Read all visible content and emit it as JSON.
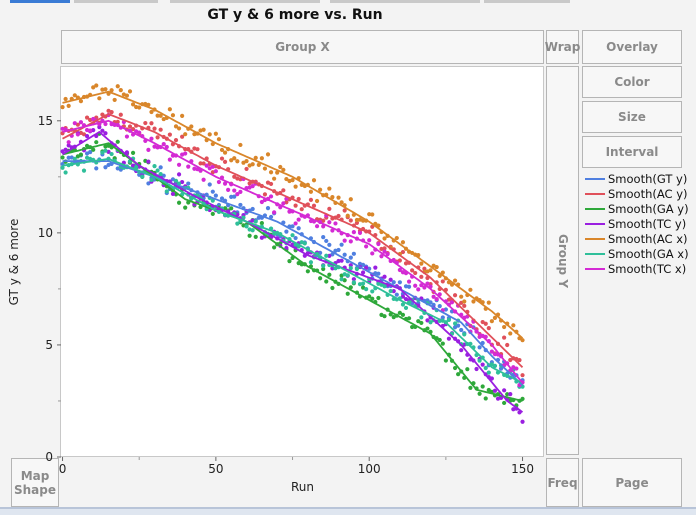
{
  "title": "GT y & 6 more vs. Run",
  "zones": {
    "group_x": "Group X",
    "wrap": "Wrap",
    "overlay": "Overlay",
    "color": "Color",
    "size": "Size",
    "interval": "Interval",
    "group_y": "Group Y",
    "map_shape": "Map Shape",
    "freq": "Freq",
    "page": "Page"
  },
  "chart_data": {
    "type": "scatter",
    "title": "GT y & 6 more vs. Run",
    "xlabel": "Run",
    "ylabel": "GT y & 6 more",
    "xlim": [
      -0.5,
      157
    ],
    "ylim": [
      0,
      17.4
    ],
    "xticks": [
      0,
      50,
      100,
      150
    ],
    "yticks": [
      0,
      5,
      10,
      15
    ],
    "xtick_labels": [
      "0",
      "50",
      "100",
      "150"
    ],
    "ytick_labels": [
      "0",
      "5",
      "10",
      "15"
    ],
    "legend_position": "right",
    "series": [
      {
        "name": "Smooth(GT y)",
        "color": "#4f7fe0",
        "smooth": [
          [
            0,
            13.2
          ],
          [
            15,
            13.2
          ],
          [
            30,
            12.5
          ],
          [
            50,
            11.5
          ],
          [
            70,
            10.5
          ],
          [
            90,
            9
          ],
          [
            110,
            7.5
          ],
          [
            130,
            6
          ],
          [
            140,
            4.5
          ],
          [
            150,
            3.2
          ]
        ]
      },
      {
        "name": "Smooth(AC y)",
        "color": "#e0505a",
        "smooth": [
          [
            0,
            14.2
          ],
          [
            15,
            15.3
          ],
          [
            30,
            14.5
          ],
          [
            50,
            13
          ],
          [
            75,
            11.5
          ],
          [
            100,
            10
          ],
          [
            120,
            8
          ],
          [
            135,
            6
          ],
          [
            150,
            4
          ]
        ]
      },
      {
        "name": "Smooth(GA y)",
        "color": "#2ea83a",
        "smooth": [
          [
            0,
            13.5
          ],
          [
            15,
            14
          ],
          [
            25,
            13
          ],
          [
            40,
            11.5
          ],
          [
            60,
            10.5
          ],
          [
            80,
            8.5
          ],
          [
            100,
            7
          ],
          [
            120,
            5.5
          ],
          [
            135,
            3
          ],
          [
            150,
            2.5
          ]
        ]
      },
      {
        "name": "Smooth(TC y)",
        "color": "#9a1fe0",
        "smooth": [
          [
            0,
            13.5
          ],
          [
            12,
            14.5
          ],
          [
            25,
            13
          ],
          [
            45,
            11.5
          ],
          [
            60,
            10.5
          ],
          [
            80,
            9
          ],
          [
            110,
            7.5
          ],
          [
            130,
            5
          ],
          [
            145,
            2.5
          ],
          [
            150,
            2
          ]
        ]
      },
      {
        "name": "Smooth(AC x)",
        "color": "#d9862a",
        "smooth": [
          [
            0,
            15.8
          ],
          [
            15,
            16.3
          ],
          [
            30,
            15.5
          ],
          [
            50,
            14
          ],
          [
            75,
            12.5
          ],
          [
            100,
            10.5
          ],
          [
            120,
            8.5
          ],
          [
            140,
            6.5
          ],
          [
            150,
            5.3
          ]
        ]
      },
      {
        "name": "Smooth(GA x)",
        "color": "#2fbf9a",
        "smooth": [
          [
            0,
            13
          ],
          [
            15,
            13.3
          ],
          [
            30,
            12.5
          ],
          [
            50,
            11
          ],
          [
            70,
            10
          ],
          [
            90,
            8.5
          ],
          [
            110,
            7
          ],
          [
            125,
            6
          ],
          [
            140,
            4
          ],
          [
            150,
            3.3
          ]
        ]
      },
      {
        "name": "Smooth(TC x)",
        "color": "#d42ad4",
        "smooth": [
          [
            0,
            14.5
          ],
          [
            15,
            15
          ],
          [
            30,
            14
          ],
          [
            50,
            12.5
          ],
          [
            75,
            11
          ],
          [
            100,
            9.5
          ],
          [
            120,
            7.5
          ],
          [
            140,
            5
          ],
          [
            150,
            3.3
          ]
        ]
      }
    ]
  }
}
